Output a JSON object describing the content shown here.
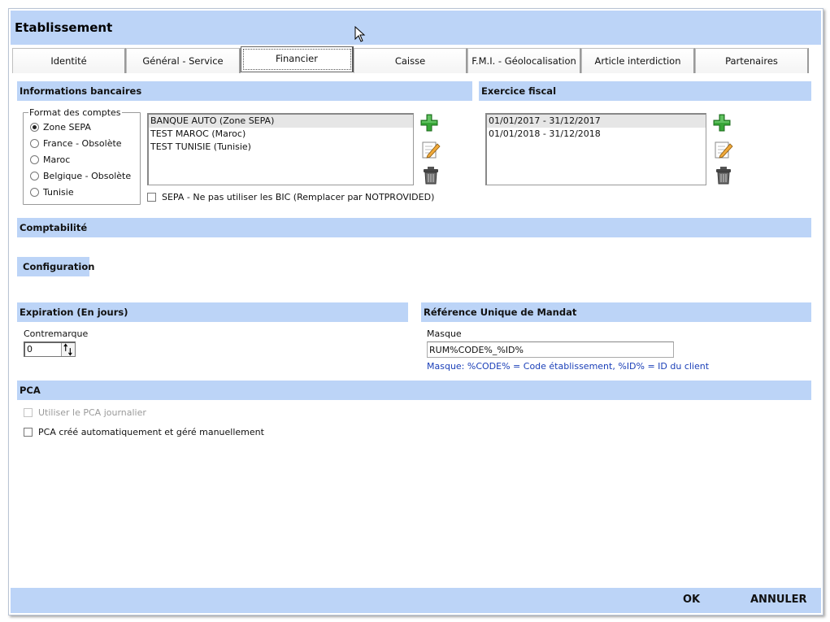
{
  "window": {
    "title": "Etablissement"
  },
  "tabs": [
    {
      "label": "Identité"
    },
    {
      "label": "Général - Service"
    },
    {
      "label": "Financier"
    },
    {
      "label": "Caisse"
    },
    {
      "label": "F.M.I. - Géolocalisation"
    },
    {
      "label": "Article interdiction"
    },
    {
      "label": "Partenaires"
    }
  ],
  "active_tab": "Financier",
  "banking": {
    "header": "Informations bancaires",
    "format_legend": "Format des comptes",
    "formats": [
      {
        "label": "Zone SEPA",
        "checked": true
      },
      {
        "label": "France - Obsolète",
        "checked": false
      },
      {
        "label": "Maroc",
        "checked": false
      },
      {
        "label": "Belgique - Obsolète",
        "checked": false
      },
      {
        "label": "Tunisie",
        "checked": false
      }
    ],
    "accounts": [
      {
        "label": "BANQUE AUTO (Zone SEPA)",
        "selected": true
      },
      {
        "label": "TEST MAROC (Maroc)",
        "selected": false
      },
      {
        "label": "TEST TUNISIE (Tunisie)",
        "selected": false
      }
    ],
    "sepa_bic_label": "SEPA - Ne pas utiliser les BIC (Remplacer par NOTPROVIDED)",
    "sepa_bic_checked": false
  },
  "fiscal": {
    "header": "Exercice fiscal",
    "periods": [
      {
        "label": "01/01/2017 - 31/12/2017",
        "selected": true
      },
      {
        "label": "01/01/2018 - 31/12/2018",
        "selected": false
      }
    ]
  },
  "comptabilite": {
    "header": "Comptabilité",
    "config_button": "Configuration"
  },
  "expiration": {
    "header": "Expiration (En jours)",
    "contremarque_label": "Contremarque",
    "contremarque_value": "0"
  },
  "rum": {
    "header": "Référence Unique de Mandat",
    "mask_label": "Masque",
    "mask_value": "RUM%CODE%_%ID%",
    "hint": "Masque: %CODE% = Code établissement, %ID% = ID du client"
  },
  "pca": {
    "header": "PCA",
    "daily_label": "Utiliser le PCA journalier",
    "daily_enabled": false,
    "auto_label": "PCA créé automatiquement et géré manuellement",
    "auto_checked": false
  },
  "footer": {
    "ok_label": "OK",
    "cancel_label": "ANNULER"
  },
  "colors": {
    "header_bg": "#bcd4f7",
    "hint_text": "#1a3fb8",
    "add_icon": "#2e9b2e"
  }
}
